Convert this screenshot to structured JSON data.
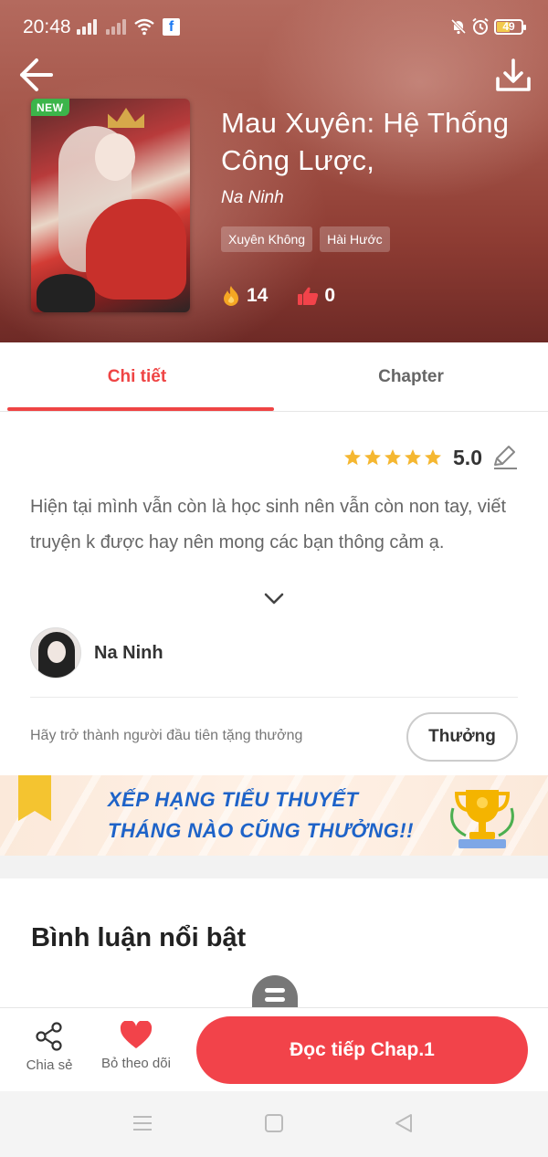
{
  "status_bar": {
    "time": "20:48",
    "battery": "49"
  },
  "book": {
    "badge": "NEW",
    "title": "Mau Xuyên: Hệ Thống Công Lược,",
    "author": "Na Ninh",
    "tags": [
      "Xuyên Không",
      "Hài Hước"
    ],
    "hot_count": "14",
    "like_count": "0"
  },
  "tabs": [
    {
      "label": "Chi tiết",
      "active": true
    },
    {
      "label": "Chapter",
      "active": false
    }
  ],
  "rating": {
    "stars": 5,
    "score": "5.0"
  },
  "description": "Hiện tại mình vẫn còn là học sinh nên vẫn còn non tay, viết truyện k được hay nên mong các bạn thông cảm ạ.",
  "author_card": {
    "name": "Na Ninh"
  },
  "reward": {
    "text": "Hãy trở thành người đầu tiên tặng thưởng",
    "button": "Thưởng"
  },
  "banner": {
    "line1": "XẾP HẠNG TIỂU THUYẾT",
    "line2": "THÁNG NÀO CŨNG THƯỞNG!!"
  },
  "comments": {
    "title": "Bình luận nổi bật"
  },
  "bottom_bar": {
    "share_label": "Chia sẻ",
    "unfollow_label": "Bỏ theo dõi",
    "read_button": "Đọc tiếp Chap.1"
  },
  "colors": {
    "accent": "#ef4444",
    "read_button": "#f2434a",
    "banner_text": "#1e63c8",
    "new_badge": "#3cb54a"
  }
}
